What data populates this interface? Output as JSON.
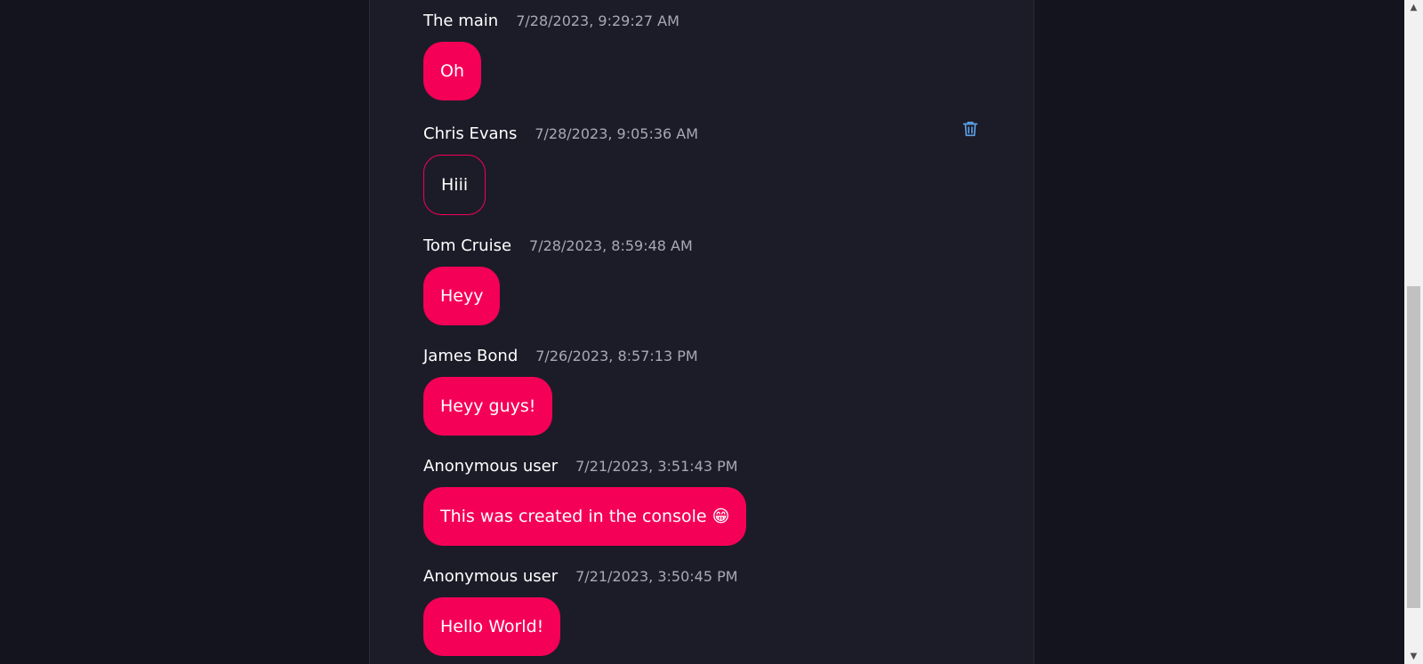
{
  "messages": [
    {
      "author": "The main",
      "timestamp": "7/28/2023, 9:29:27 AM",
      "text": "Oh",
      "style": "filled"
    },
    {
      "author": "Chris Evans",
      "timestamp": "7/28/2023, 9:05:36 AM",
      "text": "Hiii",
      "style": "outlined",
      "deletable": true
    },
    {
      "author": "Tom Cruise",
      "timestamp": "7/28/2023, 8:59:48 AM",
      "text": "Heyy",
      "style": "filled"
    },
    {
      "author": "James Bond",
      "timestamp": "7/26/2023, 8:57:13 PM",
      "text": "Heyy guys!",
      "style": "filled"
    },
    {
      "author": "Anonymous user",
      "timestamp": "7/21/2023, 3:51:43 PM",
      "text": "This was created in the console 😁",
      "style": "filled"
    },
    {
      "author": "Anonymous user",
      "timestamp": "7/21/2023, 3:50:45 PM",
      "text": "Hello World!",
      "style": "filled"
    }
  ],
  "icons": {
    "delete": "trash-icon",
    "scroll_up": "triangle-up",
    "scroll_down": "triangle-down"
  },
  "colors": {
    "page_background": "#13141d",
    "panel_background": "#1c1c28",
    "bubble_accent": "#f50057",
    "author_text": "#ffffff",
    "timestamp_text": "#a7a9b4",
    "trash_icon": "#5aa0e6"
  }
}
